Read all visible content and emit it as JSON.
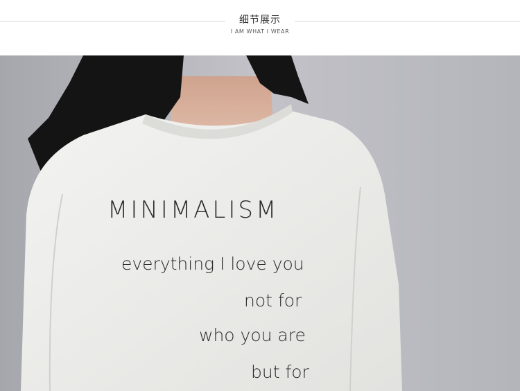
{
  "header": {
    "title_cn": "细节展示",
    "subtitle_en": "I AM WHAT I WEAR"
  },
  "photo": {
    "description_icon": "photo-image",
    "shirt_lines": {
      "line1": "MINIMALISM",
      "line2": "everything I love you",
      "line3": "not for",
      "line4": "who you are",
      "line5": "but for"
    },
    "colors": {
      "background": "#b9b9bf",
      "shirt": "#ecece9",
      "hair": "#141414",
      "skin": "#d8b3a0"
    }
  }
}
